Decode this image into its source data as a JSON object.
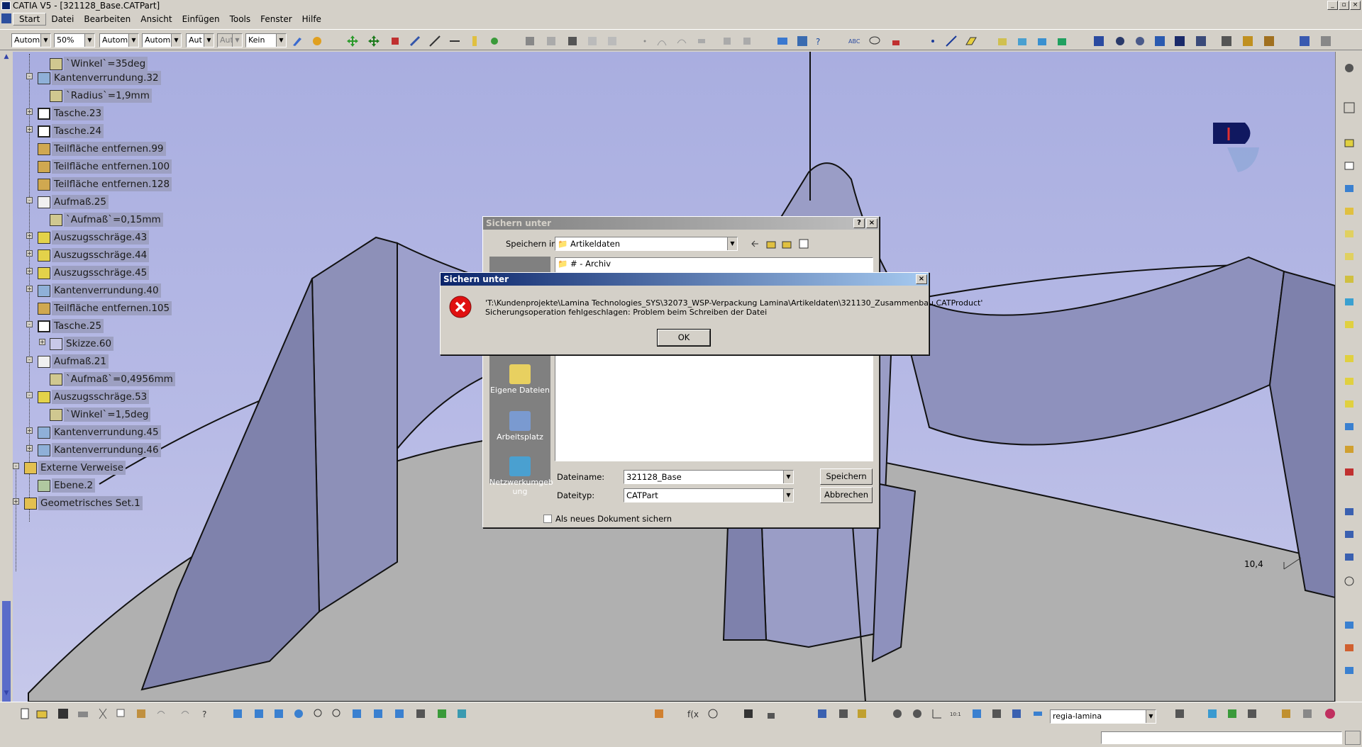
{
  "window": {
    "title": "CATIA V5 - [321128_Base.CATPart]",
    "controls": [
      "_",
      "▫",
      "×"
    ]
  },
  "menu": [
    "Start",
    "Datei",
    "Bearbeiten",
    "Ansicht",
    "Einfügen",
    "Tools",
    "Fenster",
    "Hilfe"
  ],
  "toolbar": {
    "combos": [
      "Automa",
      "50%",
      "Automa",
      "Automa",
      "Aut",
      "Aut",
      "Kein"
    ]
  },
  "tree": {
    "items": [
      {
        "label": "`Winkel`=35deg"
      },
      {
        "label": "Kantenverrundung.32"
      },
      {
        "label": "`Radius`=1,9mm"
      },
      {
        "label": "Tasche.23"
      },
      {
        "label": "Tasche.24"
      },
      {
        "label": "Teilfläche entfernen.99"
      },
      {
        "label": "Teilfläche entfernen.100"
      },
      {
        "label": "Teilfläche entfernen.128"
      },
      {
        "label": "Aufmaß.25"
      },
      {
        "label": "`Aufmaß`=0,15mm"
      },
      {
        "label": "Auszugsschräge.43"
      },
      {
        "label": "Auszugsschräge.44"
      },
      {
        "label": "Auszugsschräge.45"
      },
      {
        "label": "Kantenverrundung.40"
      },
      {
        "label": "Teilfläche entfernen.105"
      },
      {
        "label": "Tasche.25"
      },
      {
        "label": "Skizze.60"
      },
      {
        "label": "Aufmaß.21"
      },
      {
        "label": "`Aufmaß`=0,4956mm"
      },
      {
        "label": "Auszugsschräge.53"
      },
      {
        "label": "`Winkel`=1,5deg"
      },
      {
        "label": "Kantenverrundung.45"
      },
      {
        "label": "Kantenverrundung.46"
      },
      {
        "label": "Externe Verweise"
      },
      {
        "label": "Ebene.2"
      },
      {
        "label": "Geometrisches Set.1"
      }
    ]
  },
  "save_dialog": {
    "title": "Sichern unter",
    "save_in_label": "Speichern in:",
    "save_in_value": "Artikeldaten",
    "first_item": "# - Archiv",
    "places": [
      "Eigene Dateien",
      "Arbeitsplatz",
      "Netzwerkumgeb ung"
    ],
    "filename_label": "Dateiname:",
    "filename_value": "321128_Base",
    "filetype_label": "Dateityp:",
    "filetype_value": "CATPart",
    "save_button": "Speichern",
    "cancel_button": "Abbrechen",
    "new_doc_checkbox": "Als neues Dokument sichern"
  },
  "error_dialog": {
    "title": "Sichern unter",
    "path": "'T:\\Kundenprojekte\\Lamina Technologies_SYS\\32073_WSP-Verpackung Lamina\\Artikeldaten\\321130_Zusammenbau.CATProduct'",
    "message": "Sicherungsoperation fehlgeschlagen: Problem beim Schreiben der Datei",
    "ok_button": "OK"
  },
  "viewport": {
    "scale_readout": "10,4"
  },
  "bottom": {
    "workbench_combo": "regia-lamina"
  },
  "colors": {
    "tree_highlight": "#9da0c2",
    "title_active": "#0a246a",
    "viewport_bg": "#b0b4e4"
  }
}
